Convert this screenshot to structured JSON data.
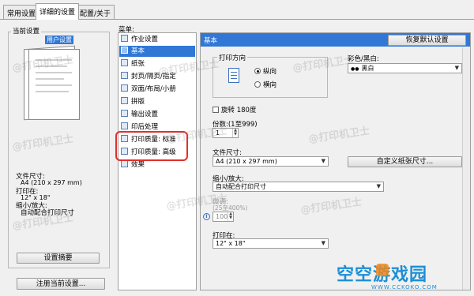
{
  "tabs": [
    "常用设置",
    "详细的设置",
    "配置/关于"
  ],
  "left": {
    "current_settings_label": "当前设置",
    "user_settings_badge": "用户设置",
    "info_lines": [
      "文件尺寸:",
      "A4 (210 x 297 mm)",
      "打印在:",
      "12\" x 18\"",
      "缩小/放大:",
      "自动配合打印尺寸"
    ],
    "summary_button": "设置摘要",
    "register_button": "注册当前设置..."
  },
  "menu": {
    "label": "菜单:",
    "items": [
      "作业设置",
      "基本",
      "纸张",
      "封页/隔页/指定",
      "双面/布局/小册",
      "拼版",
      "输出设置",
      "印后处理",
      "打印质量: 标准",
      "打印质量: 高级",
      "效果"
    ],
    "selected": "基本"
  },
  "pane": {
    "header": "基本",
    "restore_button": "恢复默认设置",
    "orientation_label": "打印方向",
    "portrait": "纵向",
    "landscape": "横向",
    "color_label": "彩色/黑白:",
    "color_value": "黑白",
    "rotate_label": "旋转 180度",
    "copies_label": "份数:(1至999)",
    "copies_value": "1",
    "paper_size_label": "文件尺寸:",
    "paper_size_value": "A4 (210 x 297 mm)",
    "custom_size_button": "自定义纸张尺寸...",
    "scale_label": "缩小/放大:",
    "scale_value": "自动配合打印尺寸",
    "zoom_label": "微调:",
    "zoom_range": "(25至400%)",
    "zoom_value": "100",
    "print_on_label": "打印在:",
    "print_on_value": "12\" x 18\""
  },
  "watermark": {
    "text": "@打印机卫士",
    "brand": "空空游戏园",
    "brand_url": "WWW.CCKOKO.COM"
  },
  "colors": {
    "accent": "#3178d6",
    "highlight_box": "#e0302a",
    "brand_blue": "#1a8fd6",
    "brand_orange": "#f08a1c"
  }
}
